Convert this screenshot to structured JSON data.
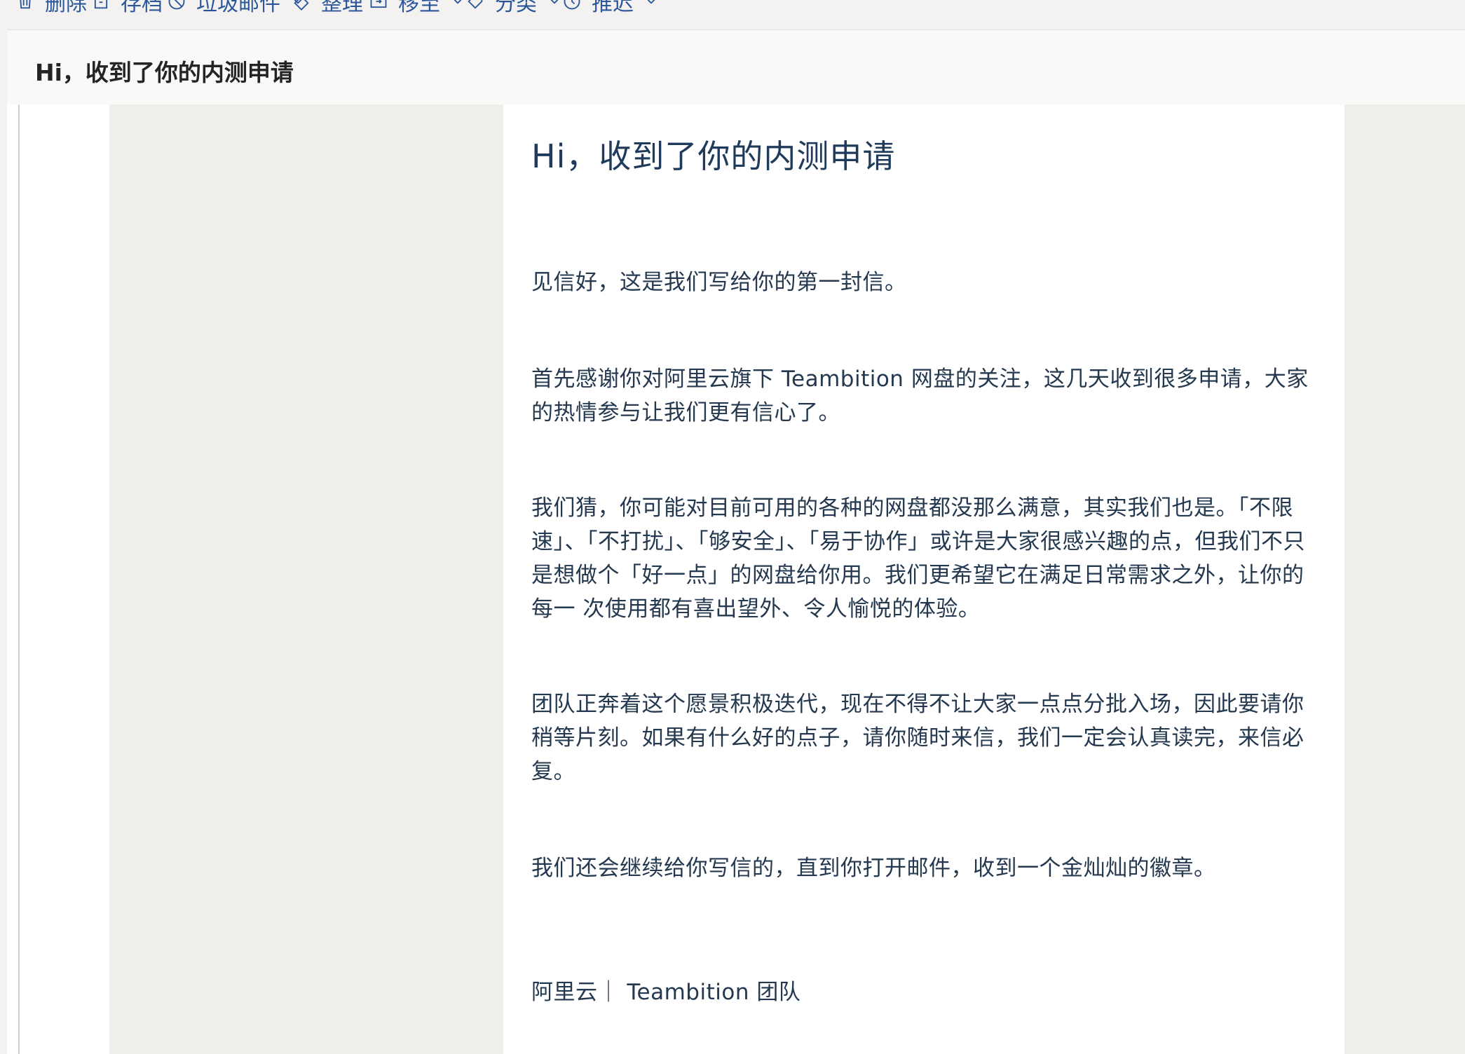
{
  "toolbar": {
    "items": [
      {
        "label": "删除",
        "icon": "trash-icon",
        "dropdown": false
      },
      {
        "label": "存档",
        "icon": "archive-icon",
        "dropdown": false
      },
      {
        "label": "垃圾邮件",
        "icon": "block-icon",
        "dropdown": true
      },
      {
        "label": "整理",
        "icon": "sweep-icon",
        "dropdown": false
      },
      {
        "label": "移至",
        "icon": "move-folder-icon",
        "dropdown": true
      },
      {
        "label": "分类",
        "icon": "tag-icon",
        "dropdown": true
      },
      {
        "label": "推迟",
        "icon": "clock-icon",
        "dropdown": true
      }
    ]
  },
  "message": {
    "subject": "Hi，收到了你的内测申请"
  },
  "email": {
    "title": "Hi，收到了你的内测申请",
    "paragraphs": [
      "见信好，这是我们写给你的第一封信。",
      "首先感谢你对阿里云旗下 Teambition 网盘的关注，这几天收到很多申请，大家的热情参与让我们更有信心了。",
      "我们猜，你可能对目前可用的各种的网盘都没那么满意，其实我们也是。「不限速」、「不打扰」、「够安全」、「易于协作」或许是大家很感兴趣的点，但我们不只是想做个「好一点」的网盘给你用。我们更希望它在满足日常需求之外，让你的每一 次使用都有喜出望外、令人愉悦的体验。",
      "团队正奔着这个愿景积极迭代，现在不得不让大家一点点分批入场，因此要请你稍等片刻。如果有什么好的点子，请你随时来信，我们一定会认真读完，来信必复。",
      "我们还会继续给你写信的，直到你打开邮件，收到一个金灿灿的徽章。"
    ],
    "signature": "阿里云｜ Teambition 团队"
  },
  "colors": {
    "accent": "#2b579a",
    "body_text": "#24384f",
    "title_text": "#1f3a5a",
    "canvas": "#efeeeb"
  }
}
